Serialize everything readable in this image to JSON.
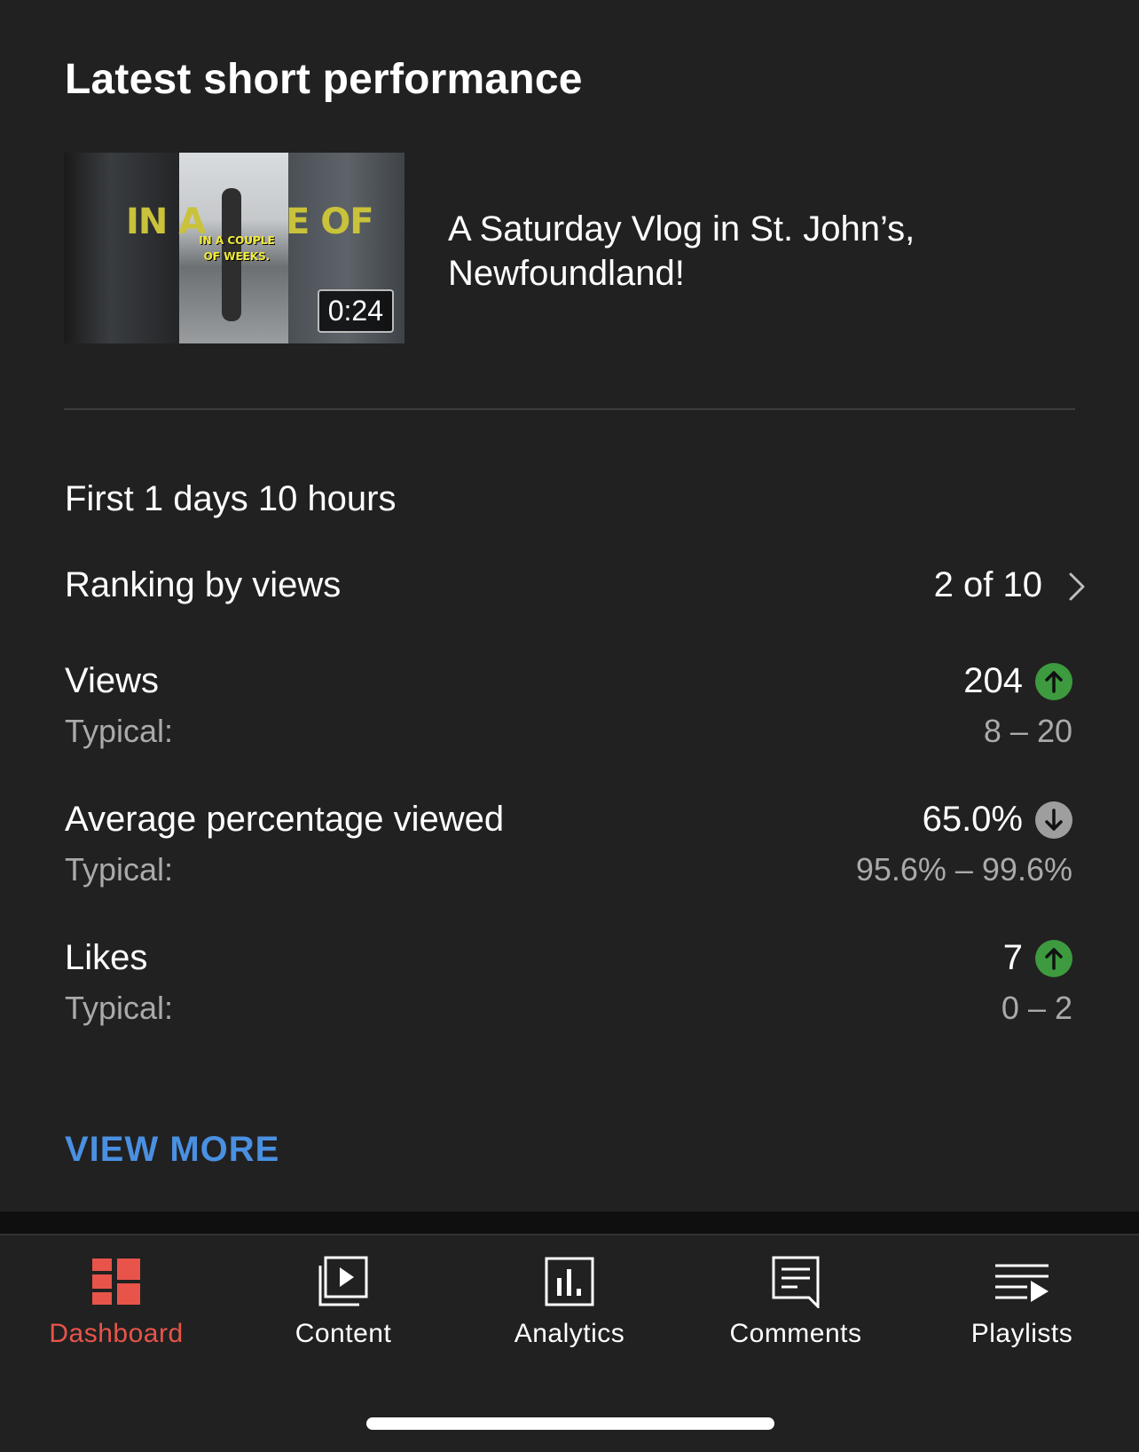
{
  "card": {
    "title": "Latest short performance",
    "video": {
      "thumbnail_text_big_left": "IN A",
      "thumbnail_text_big_right": "E OF",
      "thumbnail_caption": "IN A COUPLE OF WEEKS.",
      "duration": "0:24",
      "title": "A Saturday Vlog in St. John’s, Newfoundland!"
    },
    "period": "First 1 days 10 hours",
    "ranking": {
      "label": "Ranking by views",
      "value": "2 of 10"
    },
    "metrics": [
      {
        "label": "Views",
        "value": "204",
        "trend": "up",
        "typical_label": "Typical:",
        "typical_value": "8 – 20"
      },
      {
        "label": "Average percentage viewed",
        "value": "65.0%",
        "trend": "down",
        "typical_label": "Typical:",
        "typical_value": "95.6% – 99.6%"
      },
      {
        "label": "Likes",
        "value": "7",
        "trend": "up",
        "typical_label": "Typical:",
        "typical_value": "0 – 2"
      }
    ],
    "view_more": "VIEW MORE"
  },
  "nav": {
    "items": [
      {
        "label": "Dashboard",
        "icon": "dashboard-icon",
        "active": true
      },
      {
        "label": "Content",
        "icon": "content-icon",
        "active": false
      },
      {
        "label": "Analytics",
        "icon": "analytics-icon",
        "active": false
      },
      {
        "label": "Comments",
        "icon": "comments-icon",
        "active": false
      },
      {
        "label": "Playlists",
        "icon": "playlists-icon",
        "active": false
      }
    ]
  },
  "colors": {
    "background": "#212121",
    "accent_active": "#e8544a",
    "link": "#4a90e2",
    "trend_up": "#3d9a3f",
    "trend_down": "#9e9e9e",
    "secondary_text": "#aaaaaa"
  }
}
